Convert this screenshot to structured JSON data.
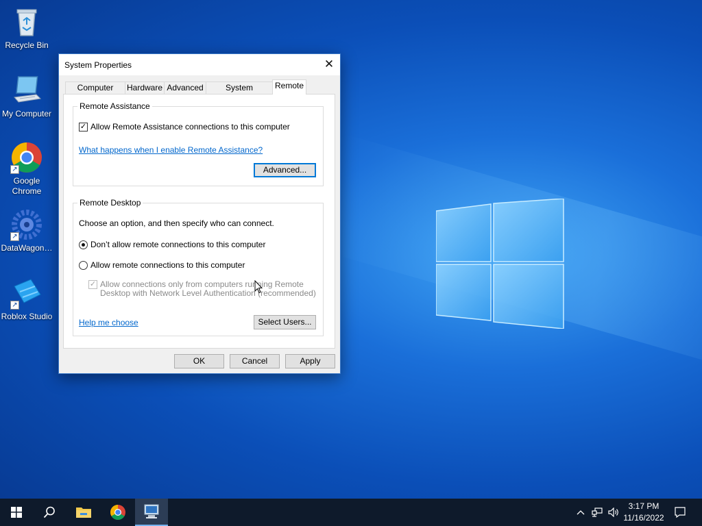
{
  "desktop": {
    "icons": [
      {
        "label": "Recycle Bin",
        "icon": "recycle-bin-icon"
      },
      {
        "label": "My Computer",
        "icon": "computer-icon"
      },
      {
        "label": "Google Chrome",
        "icon": "chrome-icon"
      },
      {
        "label": "DataWagon…",
        "icon": "datawagon-icon"
      },
      {
        "label": "Roblox Studio",
        "icon": "roblox-studio-icon"
      }
    ]
  },
  "dialog": {
    "title": "System Properties",
    "close_symbol": "✕",
    "tabs": [
      {
        "label": "Computer Name"
      },
      {
        "label": "Hardware"
      },
      {
        "label": "Advanced"
      },
      {
        "label": "System Protection"
      },
      {
        "label": "Remote"
      }
    ],
    "active_tab": "Remote",
    "remote_assistance": {
      "group_label": "Remote Assistance",
      "allow_checkbox_label": "Allow Remote Assistance connections to this computer",
      "allow_checked": true,
      "help_link": "What happens when I enable Remote Assistance?",
      "advanced_button": "Advanced..."
    },
    "remote_desktop": {
      "group_label": "Remote Desktop",
      "instruction": "Choose an option, and then specify who can connect.",
      "option_dont_allow": "Don’t allow remote connections to this computer",
      "option_allow": "Allow remote connections to this computer",
      "selected_option": "dont_allow",
      "nla_line1": "Allow connections only from computers running Remote",
      "nla_line2": "Desktop with Network Level Authentication (recommended)",
      "nla_checked": true,
      "nla_enabled": false,
      "help_link": "Help me choose",
      "select_users_button": "Select Users..."
    },
    "buttons": {
      "ok": "OK",
      "cancel": "Cancel",
      "apply": "Apply"
    }
  },
  "taskbar": {
    "pinned": [
      "windows-start-icon",
      "search-icon",
      "file-explorer-icon",
      "chrome-icon",
      "system-properties-icon"
    ],
    "tray": {
      "chevron": "^",
      "time": "3:17 PM",
      "date": "11/16/2022"
    }
  },
  "colors": {
    "accent": "#0078d7",
    "link": "#0066cc",
    "taskbar": "#0e1a2b",
    "desktop_blue": "#0b4fb8"
  }
}
